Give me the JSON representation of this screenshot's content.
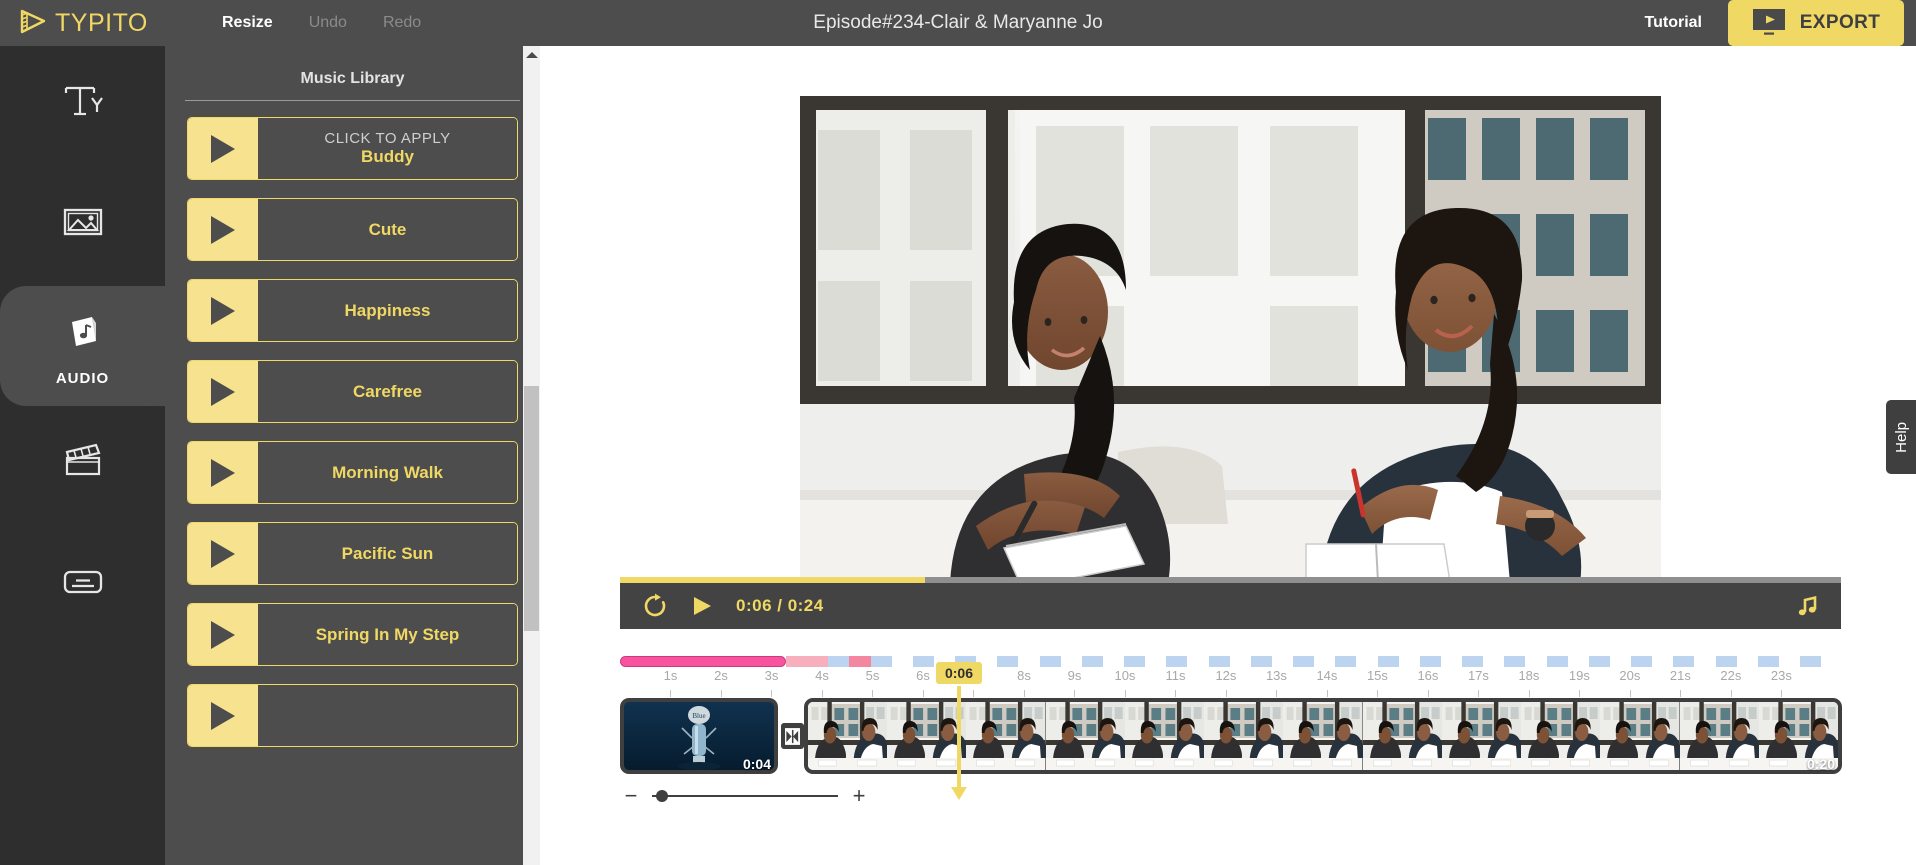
{
  "app": {
    "brand": "TYPITO",
    "doc_title": "Episode#234-Clair & Maryanne Jo",
    "accent": "#f0d864",
    "panel_bg": "#4d4d4d",
    "rail_bg": "#2e2e2e"
  },
  "topbar": {
    "resize_label": "Resize",
    "undo_label": "Undo",
    "redo_label": "Redo",
    "tutorial_label": "Tutorial",
    "export_label": "EXPORT",
    "logo_icon": "typito-film-play-icon",
    "export_icon": "monitor-play-icon"
  },
  "rail": {
    "items": [
      {
        "label": "",
        "icon": "text-ty-icon",
        "active": false
      },
      {
        "label": "",
        "icon": "image-icon",
        "active": false
      },
      {
        "label": "AUDIO",
        "icon": "audio-file-note-icon",
        "active": true
      },
      {
        "label": "",
        "icon": "clapperboard-icon",
        "active": false
      },
      {
        "label": "",
        "icon": "subtitle-caption-icon",
        "active": false
      }
    ]
  },
  "panel": {
    "title": "Music Library",
    "scroll_up_icon": "chevron-up-icon",
    "tracks": [
      {
        "name": "Buddy",
        "hint": "CLICK TO APPLY",
        "play_icon": "play-icon"
      },
      {
        "name": "Cute",
        "hint": "",
        "play_icon": "play-icon"
      },
      {
        "name": "Happiness",
        "hint": "",
        "play_icon": "play-icon"
      },
      {
        "name": "Carefree",
        "hint": "",
        "play_icon": "play-icon"
      },
      {
        "name": "Morning Walk",
        "hint": "",
        "play_icon": "play-icon"
      },
      {
        "name": "Pacific Sun",
        "hint": "",
        "play_icon": "play-icon"
      },
      {
        "name": "Spring In My Step",
        "hint": "",
        "play_icon": "play-icon"
      },
      {
        "name": "",
        "hint": "",
        "play_icon": "play-icon"
      }
    ]
  },
  "player": {
    "current_time": "0:06",
    "total_time": "0:24",
    "time_readout": "0:06 / 0:24",
    "progress_percent": 25,
    "replay_icon": "replay-icon",
    "play_icon": "play-icon",
    "audio_icon": "music-note-icon"
  },
  "timeline": {
    "playhead_label": "0:06",
    "playhead_percent": 27.7,
    "audio_region_color": "#f8539e",
    "tick_labels": [
      "1s",
      "2s",
      "3s",
      "4s",
      "5s",
      "6s",
      "7s",
      "8s",
      "9s",
      "10s",
      "11s",
      "12s",
      "13s",
      "14s",
      "15s",
      "16s",
      "17s",
      "18s",
      "19s",
      "20s",
      "21s",
      "22s",
      "23s"
    ],
    "clips": [
      {
        "name": "audio-clip",
        "duration": "0:04",
        "kind": "audio"
      },
      {
        "name": "video-clip",
        "duration": "0:20",
        "kind": "video"
      }
    ],
    "transition_icon": "transition-icon",
    "zoom_out_label": "−",
    "zoom_in_label": "+",
    "zoom_value": 2
  },
  "help": {
    "label": "Help"
  }
}
